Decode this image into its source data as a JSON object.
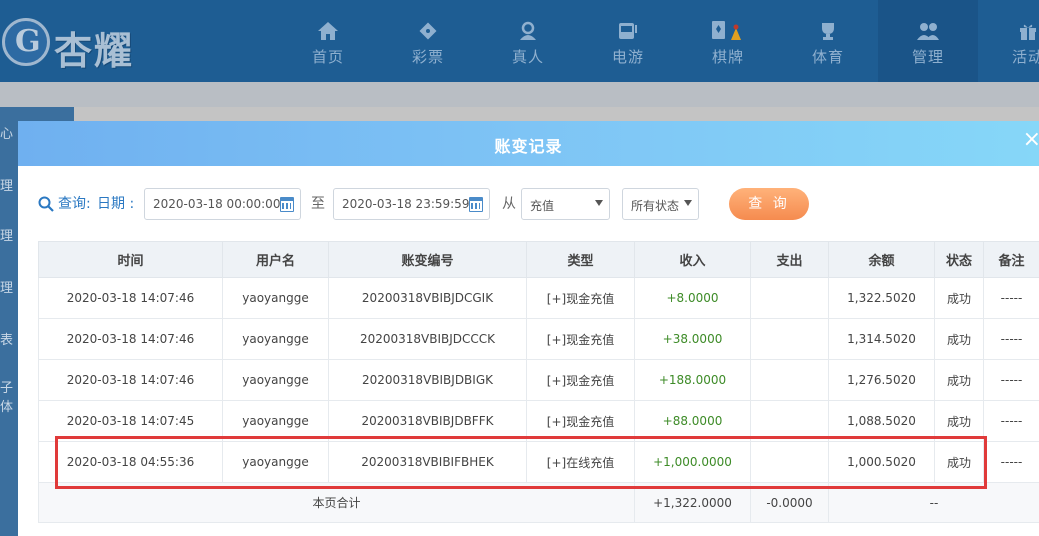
{
  "header": {
    "logo_text": "杏耀",
    "nav": [
      {
        "label": "首页",
        "icon": "home-icon"
      },
      {
        "label": "彩票",
        "icon": "lottery-icon"
      },
      {
        "label": "真人",
        "icon": "live-dealer-icon"
      },
      {
        "label": "电游",
        "icon": "slot-machine-icon"
      },
      {
        "label": "棋牌",
        "icon": "cards-icon"
      },
      {
        "label": "体育",
        "icon": "trophy-icon"
      },
      {
        "label": "管理",
        "icon": "users-icon"
      },
      {
        "label": "活动",
        "icon": "gift-icon"
      }
    ]
  },
  "sidebar": {
    "items": [
      "心",
      "理",
      "理",
      "理",
      "表",
      "子体"
    ]
  },
  "modal": {
    "title": "账变记录",
    "close": "×"
  },
  "query": {
    "label": "查询:",
    "date_label": "日期 :",
    "start_date": "2020-03-18 00:00:00",
    "to_label": "至",
    "end_date": "2020-03-18 23:59:59",
    "from_label": "从",
    "type_select": "充值",
    "status_select": "所有状态",
    "button": "查 询"
  },
  "table": {
    "headers": [
      "时间",
      "用户名",
      "账变编号",
      "类型",
      "收入",
      "支出",
      "余额",
      "状态",
      "备注"
    ],
    "rows": [
      [
        "2020-03-18 14:07:46",
        "yaoyangge",
        "20200318VBIBJDCGIK",
        "[+]现金充值",
        "+8.0000",
        "",
        "1,322.5020",
        "成功",
        "-----"
      ],
      [
        "2020-03-18 14:07:46",
        "yaoyangge",
        "20200318VBIBJDCCCK",
        "[+]现金充值",
        "+38.0000",
        "",
        "1,314.5020",
        "成功",
        "-----"
      ],
      [
        "2020-03-18 14:07:46",
        "yaoyangge",
        "20200318VBIBJDBIGK",
        "[+]现金充值",
        "+188.0000",
        "",
        "1,276.5020",
        "成功",
        "-----"
      ],
      [
        "2020-03-18 14:07:45",
        "yaoyangge",
        "20200318VBIBJDBFFK",
        "[+]现金充值",
        "+88.0000",
        "",
        "1,088.5020",
        "成功",
        "-----"
      ],
      [
        "2020-03-18 04:55:36",
        "yaoyangge",
        "20200318VBIBIFBHEK",
        "[+]在线充值",
        "+1,000.0000",
        "",
        "1,000.5020",
        "成功",
        "-----"
      ]
    ],
    "total": {
      "label": "本页合计",
      "income": "+1,322.0000",
      "expense": "-0.0000",
      "balance": "--"
    }
  },
  "colors": {
    "header_bg": "#1e5d93",
    "modal_header_start": "#6fb0f0",
    "modal_header_end": "#86d7f8",
    "accent_blue": "#2a78c2",
    "query_button": "#f58b4f",
    "income_green": "#3d8b27",
    "highlight_red": "#e03a3a"
  }
}
